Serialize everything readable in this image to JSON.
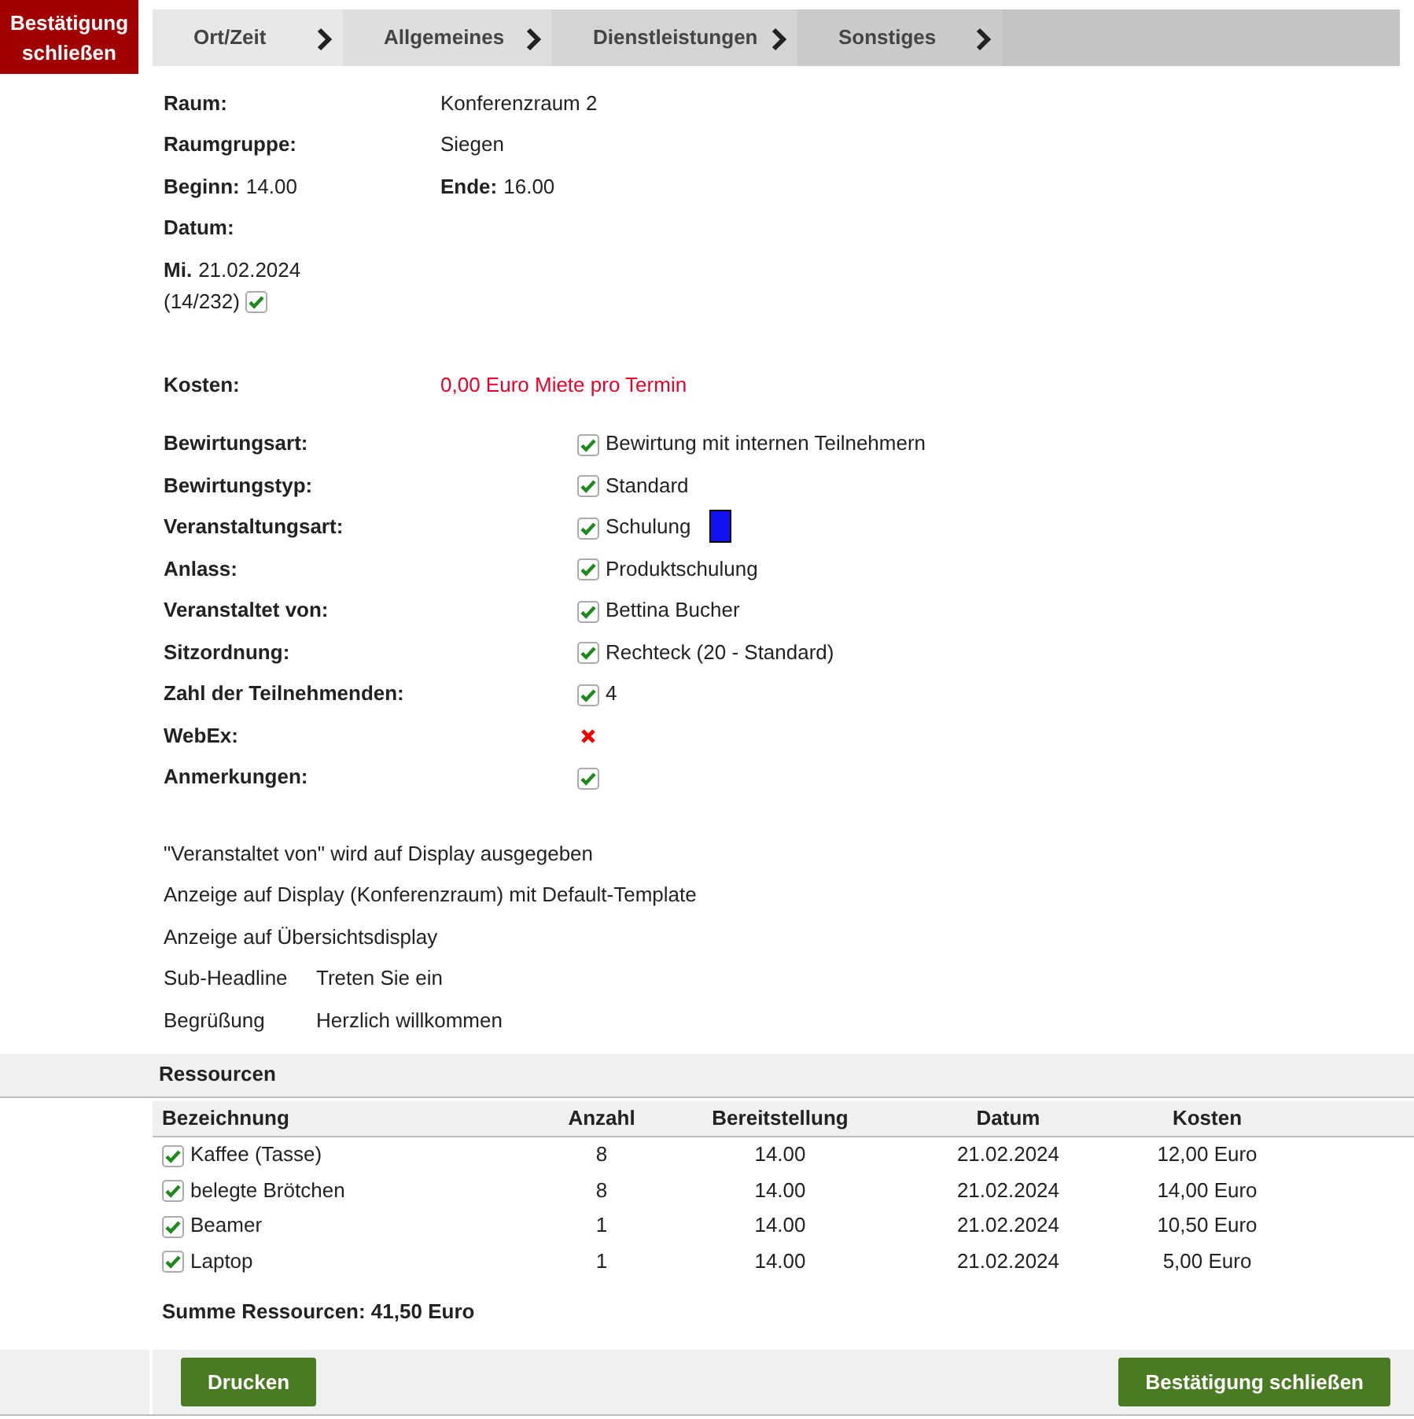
{
  "header": {
    "close_label": "Bestätigung schließen"
  },
  "steps": [
    {
      "label": "Ort/Zeit"
    },
    {
      "label": "Allgemeines"
    },
    {
      "label": "Dienstleistungen"
    },
    {
      "label": "Sonstiges"
    }
  ],
  "info": [
    {
      "label": "Raum:",
      "value": "Konferenzraum 2"
    },
    {
      "label": "Raumgruppe:",
      "value": "Siegen"
    }
  ],
  "time": {
    "begin_label": "Beginn:",
    "begin": "14.00",
    "end_label": "Ende:",
    "end": "16.00"
  },
  "date": {
    "label": "Datum:",
    "weekday": "Mi.",
    "date": "21.02.2024",
    "count": "(14/232)",
    "checked": true
  },
  "costs": {
    "label": "Kosten:",
    "value": "0,00 Euro Miete pro Termin"
  },
  "attributes": [
    {
      "label": "Bewirtungsart:",
      "checked": true,
      "value": "Bewirtung mit internen Teilnehmern"
    },
    {
      "label": "Bewirtungstyp:",
      "checked": true,
      "value": "Standard"
    },
    {
      "label": "Veranstaltungsart:",
      "checked": true,
      "value": "Schulung",
      "color": "#1010f0"
    },
    {
      "label": "Anlass:",
      "checked": true,
      "value": "Produktschulung"
    },
    {
      "label": "Veranstaltet von:",
      "checked": true,
      "value": "Bettina Bucher"
    },
    {
      "label": "Sitzordnung:",
      "checked": true,
      "value": "Rechteck (20 - Standard)"
    },
    {
      "label": "Zahl der Teilnehmenden:",
      "checked": true,
      "value": "4"
    },
    {
      "label": "WebEx:",
      "checked": false
    },
    {
      "label": "Anmerkungen:",
      "checked": true
    }
  ],
  "notes": [
    "\"Veranstaltet von\" wird auf Display ausgegeben",
    "Anzeige auf Display (Konferenzraum) mit Default-Template",
    "Anzeige auf Übersichtsdisplay"
  ],
  "display_texts": [
    {
      "label": "Sub-Headline",
      "value": "Treten Sie ein"
    },
    {
      "label": "Begrüßung",
      "value": "Herzlich willkommen"
    }
  ],
  "resources": {
    "title": "Ressourcen",
    "columns": [
      "Bezeichnung",
      "Anzahl",
      "Bereitstellung",
      "Datum",
      "Kosten"
    ],
    "rows": [
      {
        "checked": true,
        "cells": [
          "Kaffee (Tasse)",
          "8",
          "14.00",
          "21.02.2024",
          "12,00 Euro"
        ]
      },
      {
        "checked": true,
        "cells": [
          "belegte Brötchen",
          "8",
          "14.00",
          "21.02.2024",
          "14,00 Euro"
        ]
      },
      {
        "checked": true,
        "cells": [
          "Beamer",
          "1",
          "14.00",
          "21.02.2024",
          "10,50 Euro"
        ]
      },
      {
        "checked": true,
        "cells": [
          "Laptop",
          "1",
          "14.00",
          "21.02.2024",
          "5,00 Euro"
        ]
      }
    ],
    "total": "Summe Ressourcen: 41,50 Euro"
  },
  "buttons": [
    {
      "label": "Drucken"
    },
    {
      "label": "Bestätigung schließen"
    }
  ]
}
